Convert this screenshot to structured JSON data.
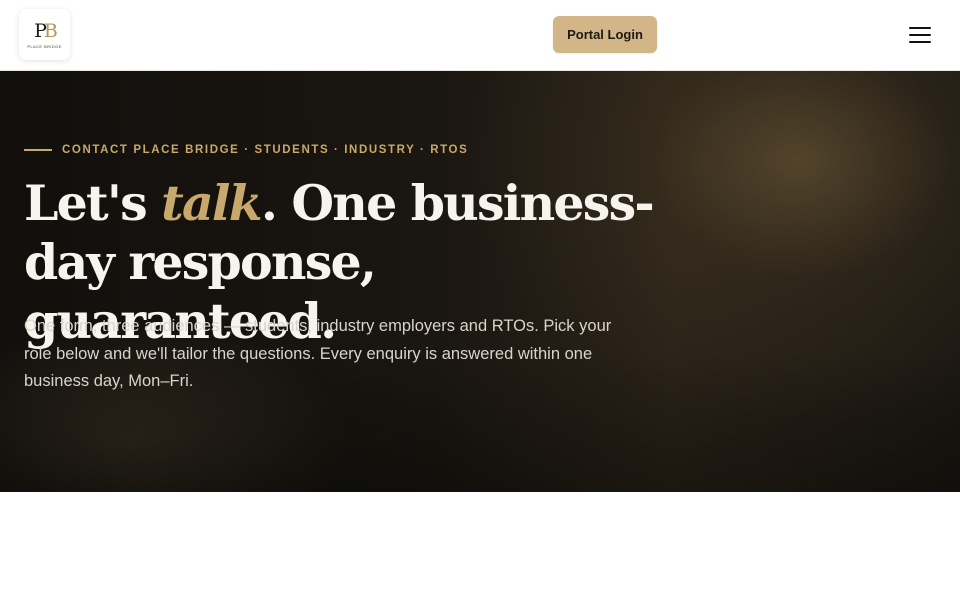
{
  "header": {
    "logo": {
      "monogram_p": "P",
      "monogram_b": "B",
      "wordmark": "PLACE BRIDGE"
    },
    "portal_login_label": "Portal Login",
    "menu_icon": "hamburger-menu-icon"
  },
  "hero": {
    "eyebrow": "CONTACT PLACE BRIDGE · STUDENTS · INDUSTRY · RTOS",
    "title_part1": "Let's ",
    "title_accent": "talk",
    "title_part2": ". One business-day response, guaranteed.",
    "description": "One form, three audiences — students, industry employers and RTOs. Pick your role below and we'll tailor the questions. Every enquiry is answered within one business day, Mon–Fri."
  },
  "colors": {
    "accent_gold": "#c9a86c",
    "button_gold": "#d2b688",
    "hero_dark": "#15120e",
    "heading_text": "#f7f4ee",
    "body_text": "#d9d4cb"
  }
}
